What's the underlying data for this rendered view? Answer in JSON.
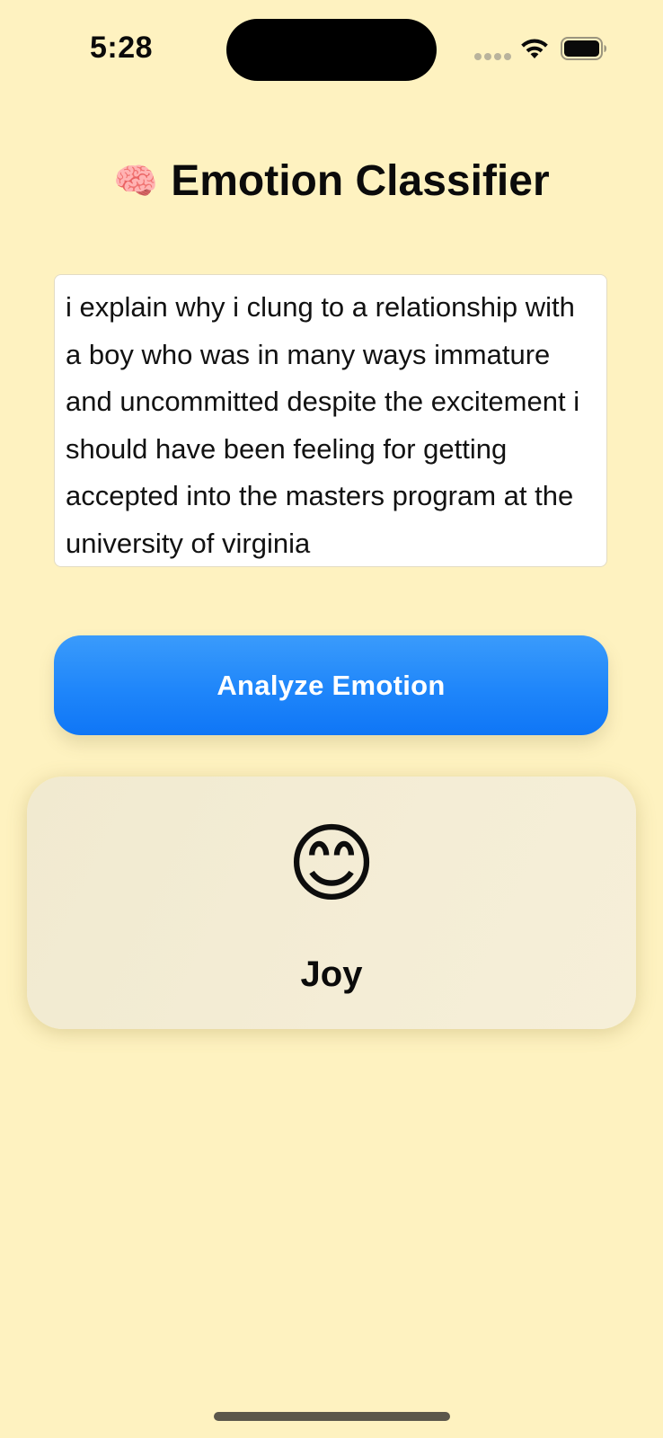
{
  "status_bar": {
    "time": "5:28",
    "icons": [
      "cellular-signal-icon",
      "wifi-icon",
      "battery-icon"
    ]
  },
  "header": {
    "icon": "🧠",
    "icon_name": "brain-icon",
    "title": "Emotion Classifier"
  },
  "input": {
    "value": "i explain why i clung to a relationship with a boy who was in many ways immature and uncommitted despite the excitement i should have been feeling for getting accepted into the masters program at the university of virginia"
  },
  "actions": {
    "analyze_label": "Analyze Emotion"
  },
  "result": {
    "emoji": "😊",
    "emoji_name": "smiling-face-icon",
    "label": "Joy"
  },
  "colors": {
    "background": "#FEF2C0",
    "button_top": "#3a9bfb",
    "button_bottom": "#0f76f6",
    "card_background": "#F3ECD4"
  }
}
